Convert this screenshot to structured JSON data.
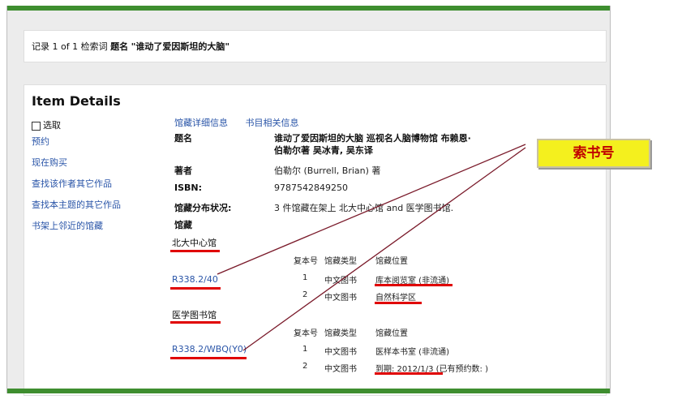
{
  "record": {
    "prefix": "记录 1 of 1 检索词",
    "field": "题名",
    "query": "\"谁动了爱因斯坦的大脑\""
  },
  "item_details": {
    "heading": "Item Details",
    "sidebar": [
      "选取",
      "预约",
      "现在购买",
      "查找该作者其它作品",
      "查找本主题的其它作品",
      "书架上邻近的馆藏"
    ],
    "tabs": [
      "馆藏详细信息",
      "书目相关信息"
    ],
    "fields": {
      "title_label": "题名",
      "title_value_1": "谁动了爱因斯坦的大脑 巡视名人脑博物馆 布赖恩·",
      "title_value_2": "伯勒尔著 吴冰青, 吴东译",
      "author_label": "著者",
      "author_value": "伯勒尔 (Burrell, Brian) 著",
      "isbn_label": "ISBN:",
      "isbn_value": "9787542849250",
      "status_label": "馆藏分布状况:",
      "status_value": "3 件馆藏在架上 北大中心馆 and 医学图书馆.",
      "holdings_label": "馆藏"
    },
    "table_headers": {
      "copy": "复本号",
      "type": "馆藏类型",
      "location": "馆藏位置"
    },
    "libraries": [
      {
        "name": "北大中心馆",
        "call_number": "R338.2/40",
        "copies": [
          {
            "copy": "1",
            "type": "中文图书",
            "location": "库本阅览室 (非流通)"
          },
          {
            "copy": "2",
            "type": "中文图书",
            "location": "自然科学区"
          }
        ]
      },
      {
        "name": "医学图书馆",
        "call_number": "R338.2/WBQ(Y0)",
        "copies": [
          {
            "copy": "1",
            "type": "中文图书",
            "location": "医样本书室 (非流通)"
          },
          {
            "copy": "2",
            "type": "中文图书",
            "location": "到期: 2012/1/3 (已有预约数: )"
          }
        ]
      }
    ]
  },
  "callout": {
    "label": "索书号"
  },
  "colors": {
    "accent_green": "#3e8e2f",
    "link_blue": "#2a55a8",
    "underline_red": "#e00000",
    "callout_yellow": "#f4f01e",
    "leader_line": "#7a1a2a"
  }
}
